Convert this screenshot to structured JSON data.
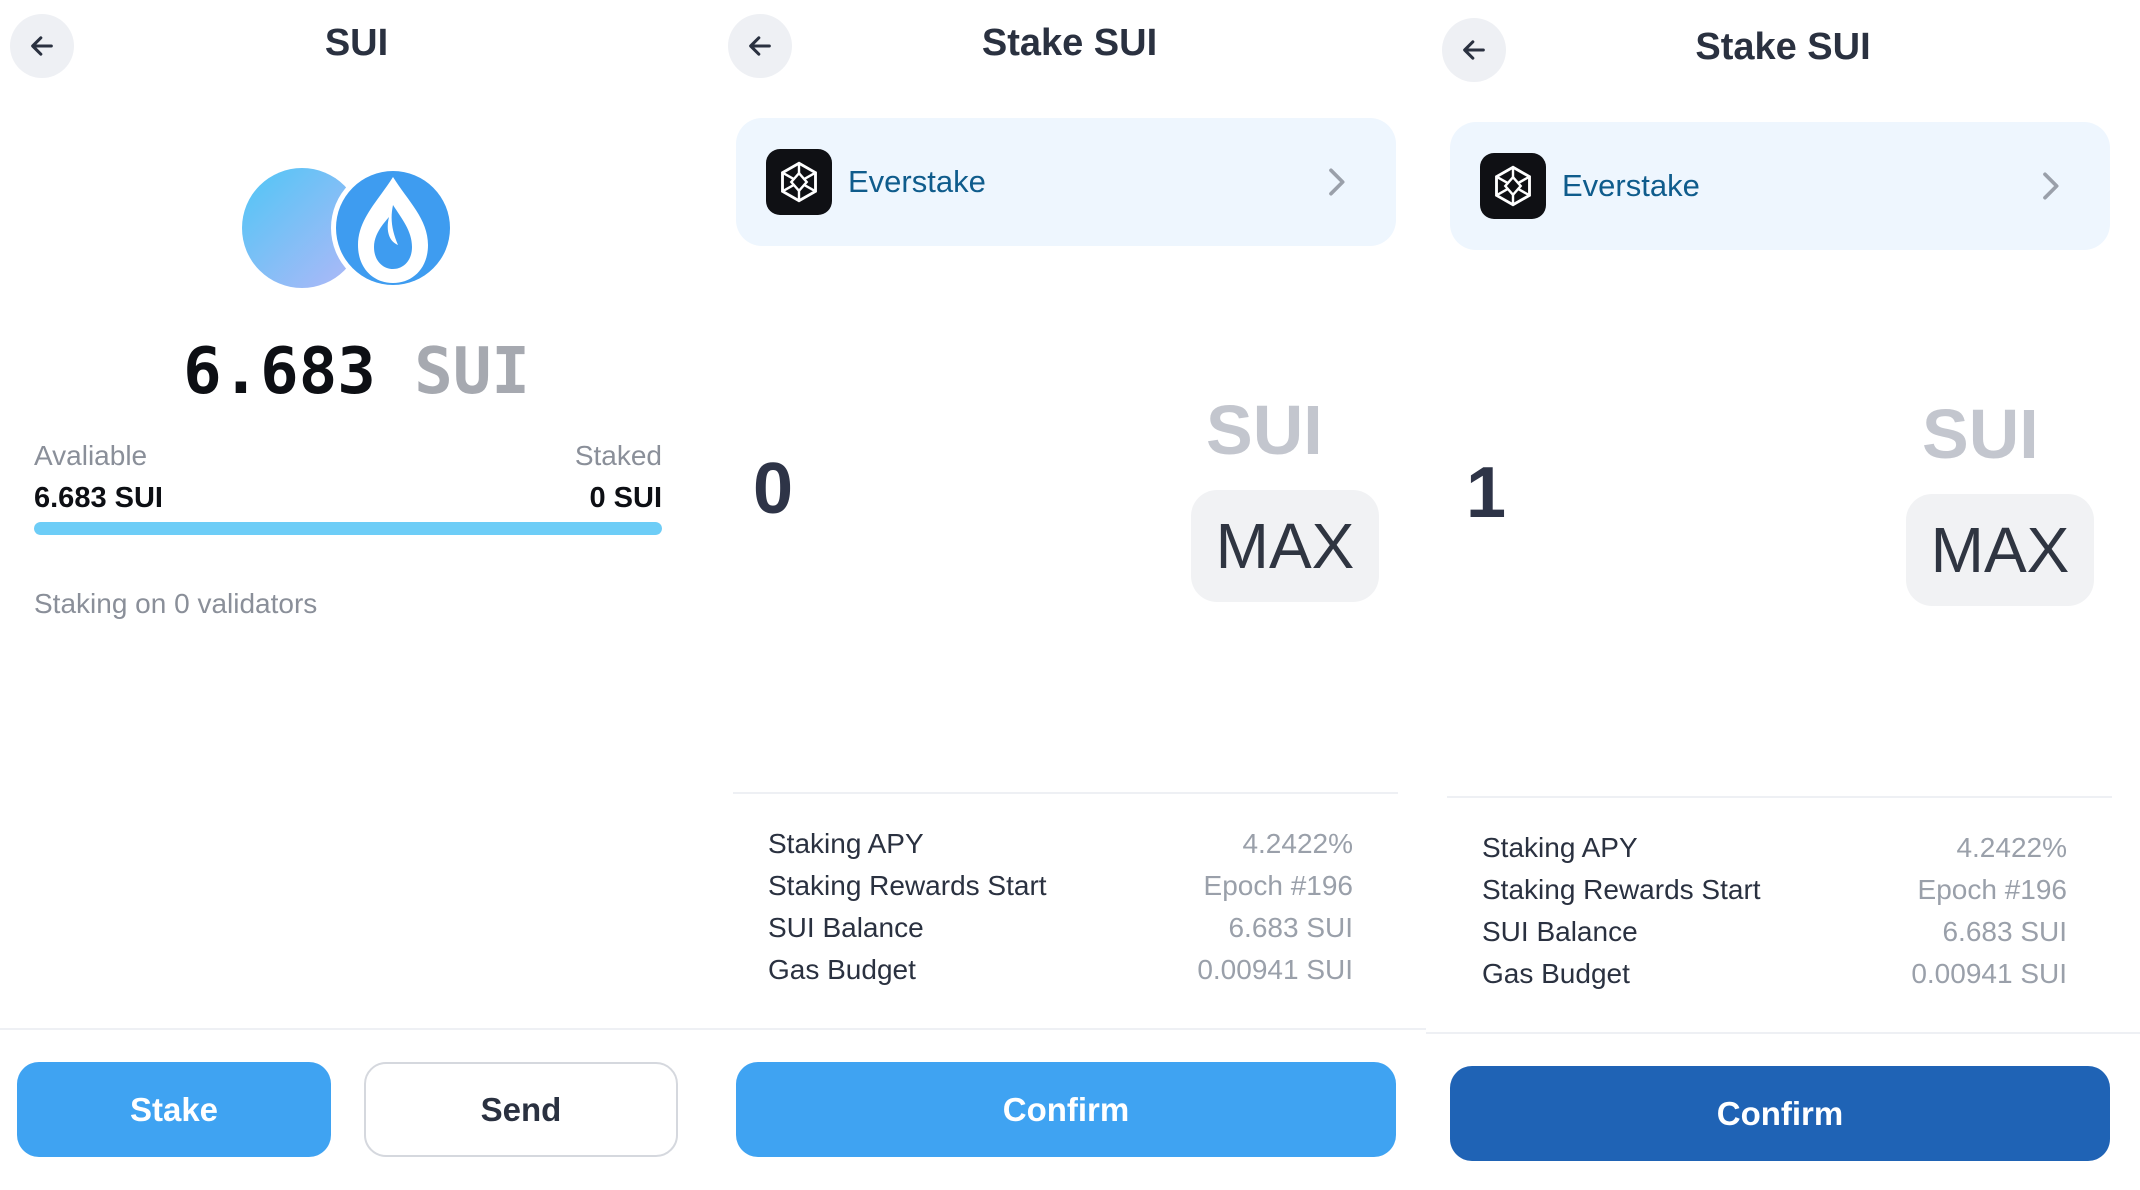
{
  "colors": {
    "primary": "#3fa3f2",
    "confirm_dark": "#1f63b5",
    "progress": "#6dcdf7",
    "validator_bg": "#eef6fe"
  },
  "overview": {
    "title": "SUI",
    "back_icon": "arrow-left-icon",
    "balance_number": "6.683",
    "balance_unit": "SUI",
    "available_label": "Avaliable",
    "available_value": "6.683 SUI",
    "staked_label": "Staked",
    "staked_value": "0 SUI",
    "available_fraction": 1.0,
    "staking_on": "Staking on 0 validators",
    "stake_button": "Stake",
    "send_button": "Send"
  },
  "stake_screens": [
    {
      "title": "Stake SUI",
      "validator_name": "Everstake",
      "amount": "0",
      "unit": "SUI",
      "max_label": "MAX",
      "info": [
        {
          "label": "Staking APY",
          "value": "4.2422%"
        },
        {
          "label": "Staking Rewards Start",
          "value": "Epoch #196"
        },
        {
          "label": "SUI Balance",
          "value": "6.683 SUI"
        },
        {
          "label": "Gas Budget",
          "value": "0.00941 SUI"
        }
      ],
      "confirm_label": "Confirm"
    },
    {
      "title": "Stake SUI",
      "validator_name": "Everstake",
      "amount": "1",
      "unit": "SUI",
      "max_label": "MAX",
      "info": [
        {
          "label": "Staking APY",
          "value": "4.2422%"
        },
        {
          "label": "Staking Rewards Start",
          "value": "Epoch #196"
        },
        {
          "label": "SUI Balance",
          "value": "6.683 SUI"
        },
        {
          "label": "Gas Budget",
          "value": "0.00941 SUI"
        }
      ],
      "confirm_label": "Confirm"
    }
  ]
}
